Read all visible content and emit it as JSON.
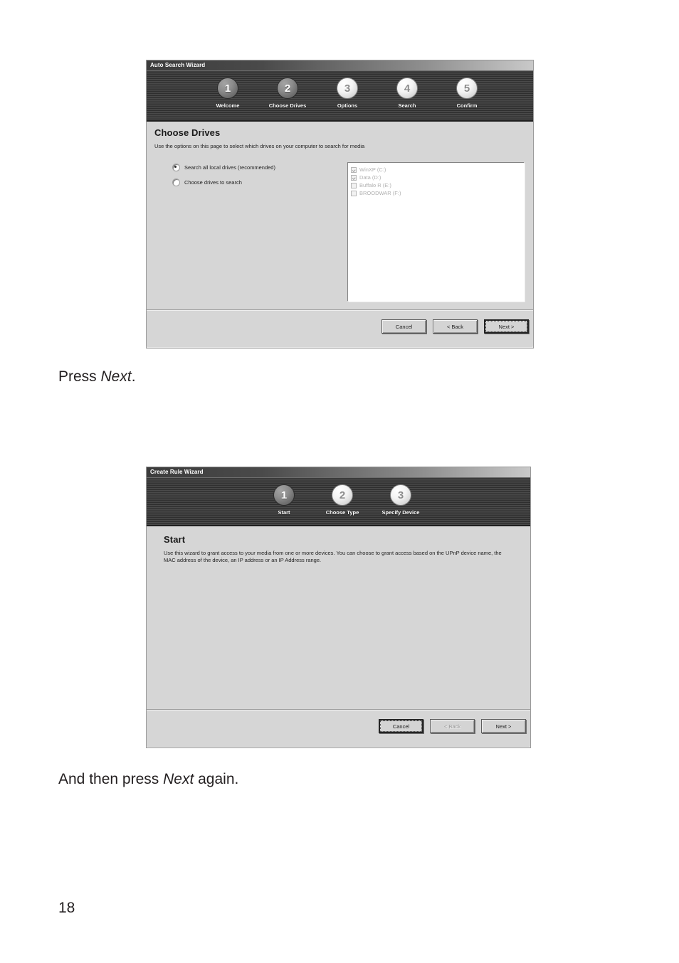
{
  "page": {
    "number": "18",
    "background": "#ffffff"
  },
  "captions": [
    {
      "prefix": "Press ",
      "emphasis": "Next",
      "suffix": "."
    },
    {
      "prefix": "And then press ",
      "emphasis": "Next",
      "suffix": " again."
    }
  ],
  "wizard1": {
    "title": "Auto Search Wizard",
    "steps": [
      {
        "number": "1",
        "label": "Welcome",
        "state": "dark"
      },
      {
        "number": "2",
        "label": "Choose Drives",
        "state": "dark"
      },
      {
        "number": "3",
        "label": "Options",
        "state": "light"
      },
      {
        "number": "4",
        "label": "Search",
        "state": "light"
      },
      {
        "number": "5",
        "label": "Confirm",
        "state": "light"
      }
    ],
    "heading": "Choose Drives",
    "subtext": "Use the options on this page to select which drives on your computer to search for media",
    "radios": [
      {
        "label": "Search all local drives (recommended)",
        "checked": true
      },
      {
        "label": "Choose drives to search",
        "checked": false
      }
    ],
    "drives": [
      {
        "label": "WinXP (C:)",
        "checked": true
      },
      {
        "label": "Data (D:)",
        "checked": true
      },
      {
        "label": "Buffalo R (E:)",
        "checked": false
      },
      {
        "label": "BROODWAR (F:)",
        "checked": false
      }
    ],
    "buttons": [
      {
        "label": "Cancel",
        "state": "normal"
      },
      {
        "label": "< Back",
        "state": "normal"
      },
      {
        "label": "Next >",
        "state": "default"
      }
    ]
  },
  "wizard2": {
    "title": "Create Rule Wizard",
    "steps": [
      {
        "number": "1",
        "label": "Start",
        "state": "dark"
      },
      {
        "number": "2",
        "label": "Choose Type",
        "state": "light"
      },
      {
        "number": "3",
        "label": "Specify Device",
        "state": "light"
      }
    ],
    "heading": "Start",
    "subtext": "Use this wizard to grant access to your media from one or more devices. You can choose to grant access based on the UPnP device name, the MAC address of the device, an IP address or an IP Address range.",
    "buttons": [
      {
        "label": "Cancel",
        "state": "default"
      },
      {
        "label": "< Back",
        "state": "disabled"
      },
      {
        "label": "Next >",
        "state": "normal"
      }
    ]
  }
}
